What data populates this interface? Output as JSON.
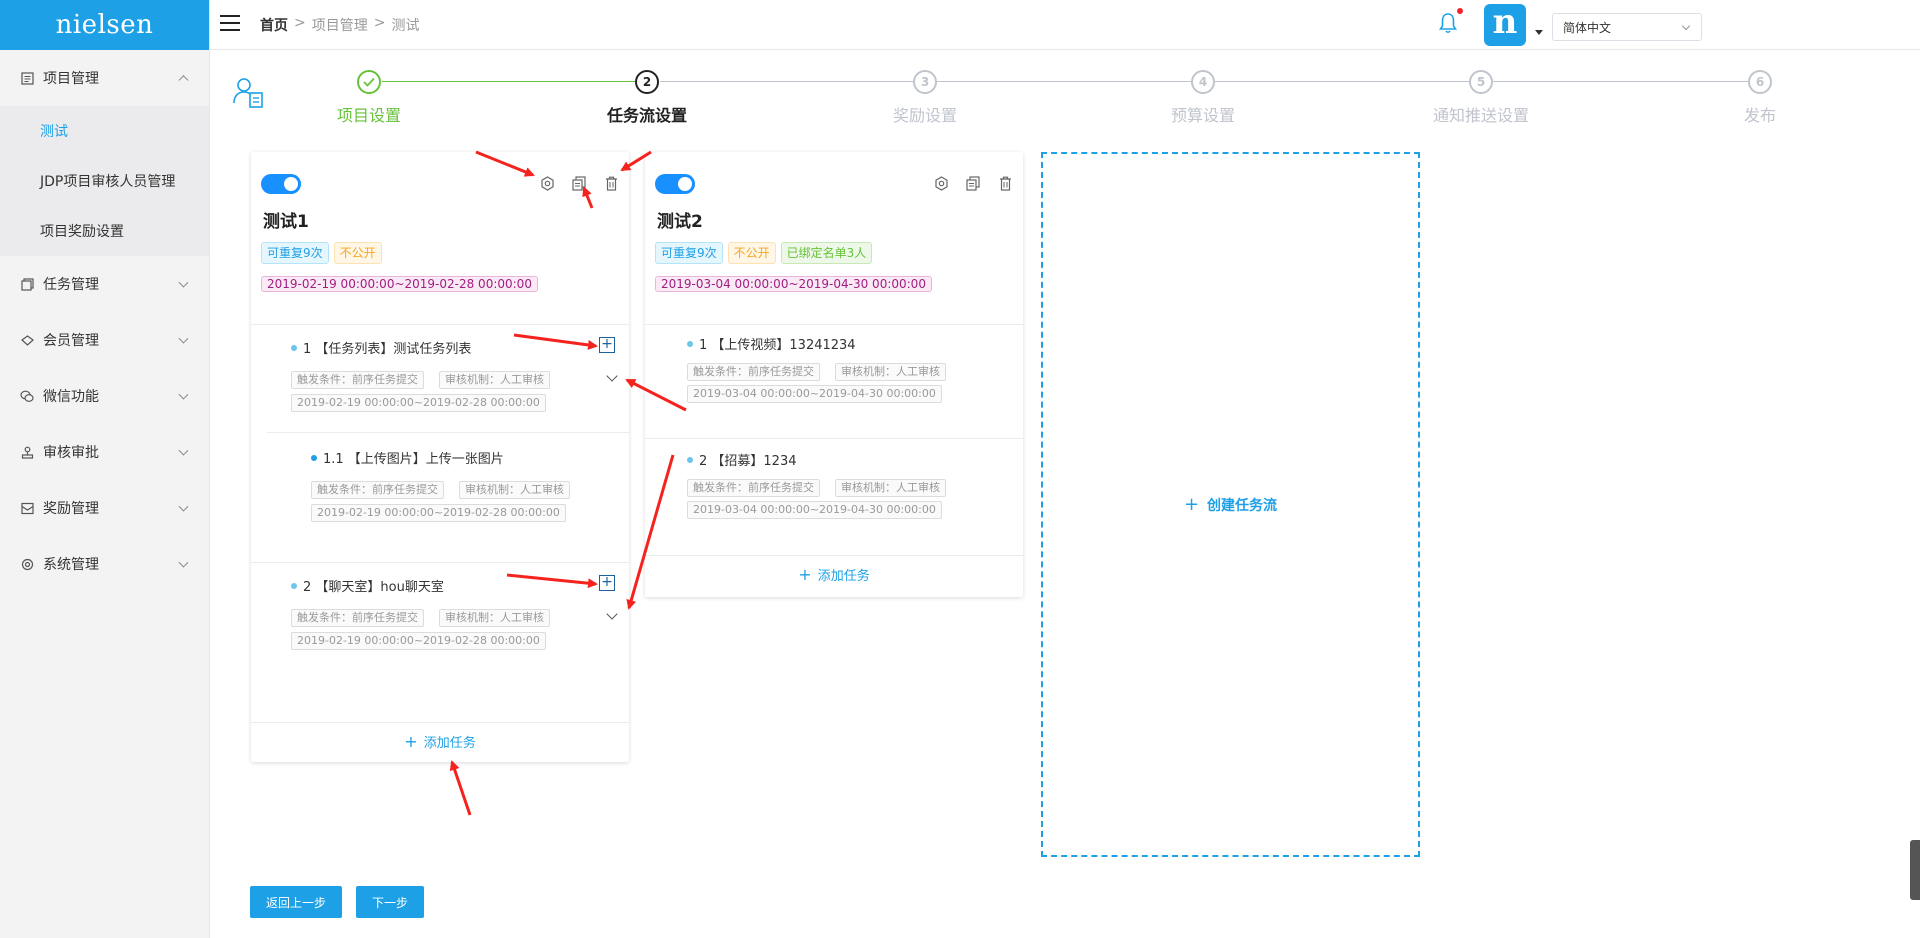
{
  "sidebar": {
    "logo": "nielsen",
    "menu": [
      {
        "label": "项目管理",
        "icon": "project-icon",
        "expanded": true,
        "children": [
          {
            "label": "测试",
            "active": true
          },
          {
            "label": "JDP项目审核人员管理"
          },
          {
            "label": "项目奖励设置"
          }
        ]
      },
      {
        "label": "任务管理",
        "icon": "task-icon"
      },
      {
        "label": "会员管理",
        "icon": "member-icon"
      },
      {
        "label": "微信功能",
        "icon": "wechat-icon"
      },
      {
        "label": "审核审批",
        "icon": "approval-icon"
      },
      {
        "label": "奖励管理",
        "icon": "reward-icon"
      },
      {
        "label": "系统管理",
        "icon": "settings-icon"
      }
    ]
  },
  "header": {
    "breadcrumb": [
      "首页",
      "项目管理",
      "测试"
    ],
    "separator": ">",
    "avatar_letter": "n",
    "language": "简体中文"
  },
  "steps": [
    {
      "index": "1",
      "label": "项目设置",
      "status": "done"
    },
    {
      "index": "2",
      "label": "任务流设置",
      "status": "active"
    },
    {
      "index": "3",
      "label": "奖励设置",
      "status": "pending"
    },
    {
      "index": "4",
      "label": "预算设置",
      "status": "pending"
    },
    {
      "index": "5",
      "label": "通知推送设置",
      "status": "pending"
    },
    {
      "index": "6",
      "label": "发布",
      "status": "pending"
    }
  ],
  "flows": [
    {
      "name": "测试1",
      "enabled": true,
      "tags": [
        "可重复9次",
        "不公开"
      ],
      "date_range": "2019-02-19 00:00:00~2019-02-28 00:00:00",
      "tasks": [
        {
          "title": "1 【任务列表】测试任务列表",
          "trigger": "触发条件：前序任务提交",
          "review": "审核机制：人工审核",
          "date": "2019-02-19 00:00:00~2019-02-28 00:00:00"
        },
        {
          "title": "1.1 【上传图片】上传一张图片",
          "trigger": "触发条件：前序任务提交",
          "review": "审核机制：人工审核",
          "date": "2019-02-19 00:00:00~2019-02-28 00:00:00"
        },
        {
          "title": "2 【聊天室】hou聊天室",
          "trigger": "触发条件：前序任务提交",
          "review": "审核机制：人工审核",
          "date": "2019-02-19 00:00:00~2019-02-28 00:00:00"
        }
      ],
      "add_task": "添加任务"
    },
    {
      "name": "测试2",
      "enabled": true,
      "tags": [
        "可重复9次",
        "不公开",
        "已绑定名单3人"
      ],
      "date_range": "2019-03-04 00:00:00~2019-04-30 00:00:00",
      "tasks": [
        {
          "title": "1 【上传视频】13241234",
          "trigger": "触发条件：前序任务提交",
          "review": "审核机制：人工审核",
          "date": "2019-03-04 00:00:00~2019-04-30 00:00:00"
        },
        {
          "title": "2 【招募】1234",
          "trigger": "触发条件：前序任务提交",
          "review": "审核机制：人工审核",
          "date": "2019-03-04 00:00:00~2019-04-30 00:00:00"
        }
      ],
      "add_task": "添加任务"
    }
  ],
  "create_flow": "创建任务流",
  "buttons": {
    "back": "返回上一步",
    "next": "下一步"
  },
  "colors": {
    "primary": "#1ea0e6",
    "success": "#67c23a",
    "annotation": "#f5231e"
  }
}
